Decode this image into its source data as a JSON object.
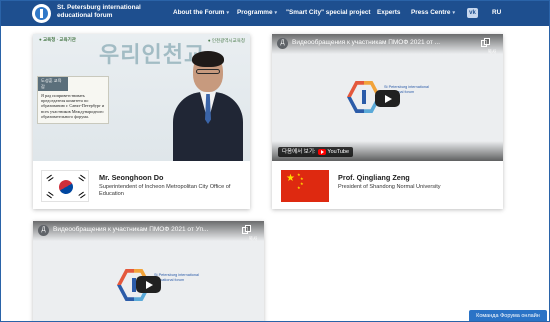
{
  "header": {
    "title_line1": "St. Petersburg international",
    "title_line2": "educational forum",
    "nav": [
      {
        "label": "About the Forum",
        "caret": "▾"
      },
      {
        "label": "Programme",
        "caret": "▾"
      },
      {
        "label": "\"Smart City\" special project",
        "caret": ""
      },
      {
        "label": "Experts",
        "caret": ""
      },
      {
        "label": "Press Centre",
        "caret": "▾"
      }
    ],
    "social_icon": "vk-icon",
    "lang": "RU",
    "bg_color": "#1e4f8f"
  },
  "speakers": [
    {
      "video": {
        "banner": "우리인천교",
        "brand_left": "● 교육청 · 교육기관",
        "brand_right": "● 인천광역시교육청",
        "subtitle_head": "도성훈 교육감",
        "subtitle_text": "Я рад поприветствовать председателя комитета по образованию г. Санкт-Петербург и всех участников Международного образовательного форума."
      },
      "flag": "south-korea-flag",
      "name": "Mr. Seonghoon Do",
      "role": "Superintendent of Incheon Metropolitan City Office of Education"
    },
    {
      "video": {
        "channel_letter": "Д",
        "title": "Видеообращения к участникам ПМОФ 2021 от ...",
        "copy_label": "복사",
        "forum_text": "St Petersburg international educational forum",
        "watch_on": "다음에서 보기:",
        "yt_brand": "YouTube"
      },
      "flag": "china-flag",
      "name": "Prof. Qingliang Zeng",
      "role": "President of Shandong Normal University"
    },
    {
      "video": {
        "channel_letter": "Д",
        "title": "Видеообращения к участникам ПМОФ 2021 от Уп...",
        "copy_label": "복사",
        "forum_text": "St Petersburg international educational forum"
      }
    }
  ],
  "help_button": "Команда Форума онлайн",
  "colors": {
    "accent": "#2a73c6",
    "youtube_red": "#ff0000"
  }
}
